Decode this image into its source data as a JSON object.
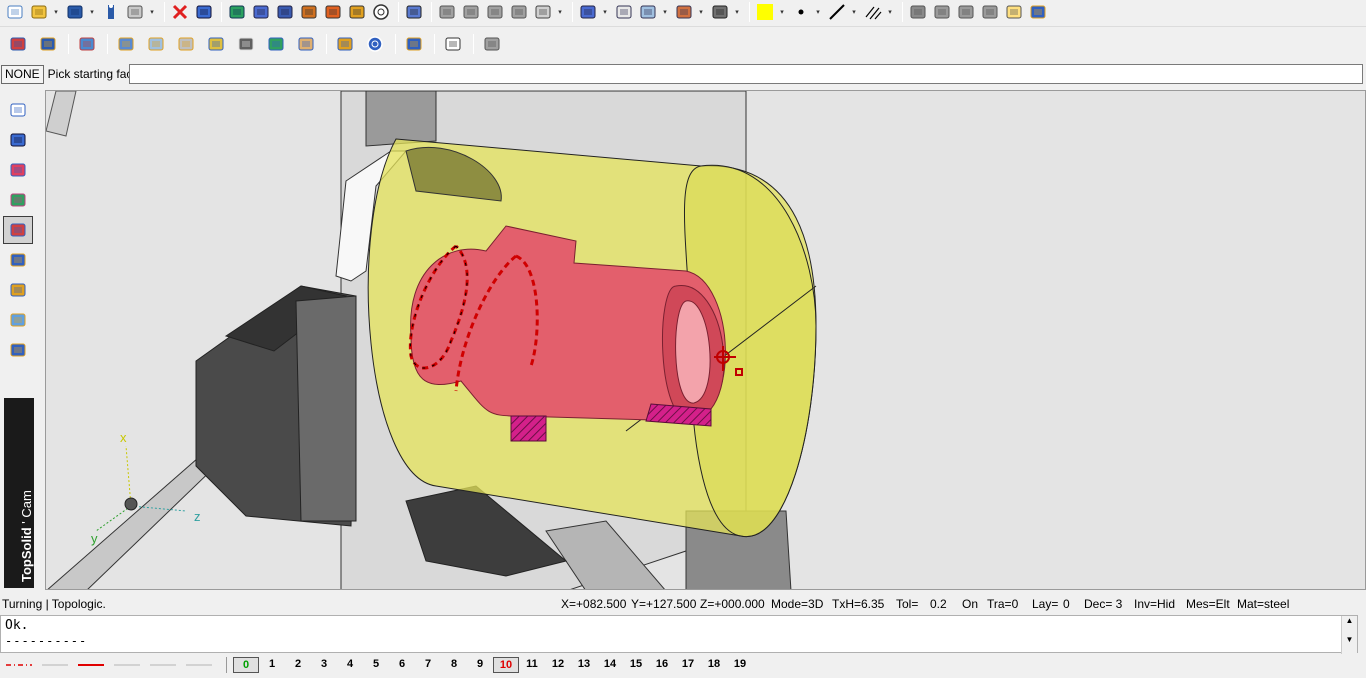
{
  "toolbar_top": {
    "items": [
      {
        "icon": "new-file-icon"
      },
      {
        "icon": "open-folder-icon",
        "dropdown": true
      },
      {
        "icon": "save-icon",
        "dropdown": true
      },
      {
        "icon": "info-icon"
      },
      {
        "icon": "print-icon",
        "dropdown": true
      },
      {
        "sep": true
      },
      {
        "icon": "delete-x-icon"
      },
      {
        "icon": "undo-icon"
      },
      {
        "sep": true
      },
      {
        "icon": "modify-icon"
      },
      {
        "icon": "zoom-search-icon"
      },
      {
        "icon": "settings-sliders-icon"
      },
      {
        "icon": "hammer-icon"
      },
      {
        "icon": "paint-icon"
      },
      {
        "icon": "brush-icon"
      },
      {
        "icon": "clock-icon"
      },
      {
        "sep": true
      },
      {
        "icon": "select-cursor-icon"
      },
      {
        "sep": true
      },
      {
        "icon": "link-icon"
      },
      {
        "icon": "cross-tool-icon"
      },
      {
        "icon": "bars-icon"
      },
      {
        "icon": "hook-icon"
      },
      {
        "icon": "list-filter-icon",
        "dropdown": true
      },
      {
        "sep": true
      },
      {
        "icon": "zoom-icon",
        "dropdown": true
      },
      {
        "icon": "zoom-window-icon"
      },
      {
        "icon": "view-export-icon",
        "dropdown": true
      },
      {
        "icon": "visibility-icon",
        "dropdown": true
      },
      {
        "icon": "snap-icon",
        "dropdown": true
      },
      {
        "sep": true
      },
      {
        "icon": "color-swatch-icon",
        "dropdown": true,
        "color": "#ffff00"
      },
      {
        "icon": "point-style-icon",
        "dropdown": true
      },
      {
        "icon": "line-style-icon",
        "dropdown": true
      },
      {
        "icon": "hatch-style-icon",
        "dropdown": true
      },
      {
        "sep": true
      },
      {
        "icon": "layer-icon"
      },
      {
        "icon": "gear-group-icon"
      },
      {
        "icon": "machine-icon"
      },
      {
        "icon": "tree-icon"
      },
      {
        "icon": "document-up-icon"
      },
      {
        "icon": "wizard-icon"
      }
    ]
  },
  "toolbar_bottom": {
    "items": [
      {
        "icon": "turning-tool-icon"
      },
      {
        "icon": "tool-holder-icon"
      },
      {
        "sep": true
      },
      {
        "icon": "stock-icon"
      },
      {
        "sep": true
      },
      {
        "icon": "facing-icon"
      },
      {
        "icon": "roughing-icon"
      },
      {
        "icon": "finishing-icon"
      },
      {
        "icon": "grooving-icon"
      },
      {
        "icon": "threading-icon"
      },
      {
        "icon": "drilling-icon"
      },
      {
        "icon": "parting-icon"
      },
      {
        "sep": true
      },
      {
        "icon": "simulation-icon"
      },
      {
        "icon": "target-icon"
      },
      {
        "sep": true
      },
      {
        "icon": "clipboard-icon"
      },
      {
        "sep": true
      },
      {
        "icon": "nc-program-icon"
      },
      {
        "sep": true
      },
      {
        "icon": "document-report-icon"
      }
    ]
  },
  "prompt": {
    "mode_button": "NONE",
    "text": "Pick starting face",
    "input_value": ""
  },
  "sidebar": {
    "items": [
      {
        "icon": "design-pencil-icon",
        "active": false
      },
      {
        "icon": "solid-cube-icon",
        "active": false
      },
      {
        "icon": "draft-icon",
        "active": false
      },
      {
        "icon": "assembly-icon",
        "active": false
      },
      {
        "icon": "cam-turning-icon",
        "active": true
      },
      {
        "icon": "machining-icon",
        "active": false
      },
      {
        "icon": "tooling-icon",
        "active": false
      },
      {
        "icon": "documents-icon",
        "active": false
      },
      {
        "icon": "simulation-people-icon",
        "active": false
      }
    ],
    "brand_main": "TopSolid",
    "brand_sep": "'",
    "brand_sub": "Cam"
  },
  "viewport": {
    "triad": {
      "x": "x",
      "y": "y",
      "z": "z"
    }
  },
  "status": {
    "left": "Turning | Topologic.",
    "x": "X=+082.500",
    "y": "Y=+127.500",
    "z": "Z=+000.000",
    "mode": "Mode=3D",
    "txh": "TxH=6.35",
    "tol": "Tol=",
    "tol_value": "0.2",
    "on": "On",
    "tra": "Tra=0",
    "lay": "Lay=",
    "lay_value": "0",
    "dec": "Dec= 3",
    "inv": "Inv=Hid",
    "mes": "Mes=Elt",
    "mat": "Mat=steel"
  },
  "console": {
    "line1": "Ok.",
    "line2": "----------"
  },
  "layers": {
    "line_types": [
      {
        "kind": "dash-dot",
        "color": "#e00000"
      },
      {
        "kind": "thin",
        "color": "#c8c8c8"
      },
      {
        "kind": "solid",
        "color": "#e00000"
      },
      {
        "kind": "thin",
        "color": "#c8c8c8"
      },
      {
        "kind": "thin",
        "color": "#c8c8c8"
      },
      {
        "kind": "thin",
        "color": "#c8c8c8"
      }
    ],
    "numbers": [
      "0",
      "1",
      "2",
      "3",
      "4",
      "5",
      "6",
      "7",
      "8",
      "9",
      "10",
      "11",
      "12",
      "13",
      "14",
      "15",
      "16",
      "17",
      "18",
      "19"
    ],
    "current_green": "0",
    "current_red": "10"
  }
}
